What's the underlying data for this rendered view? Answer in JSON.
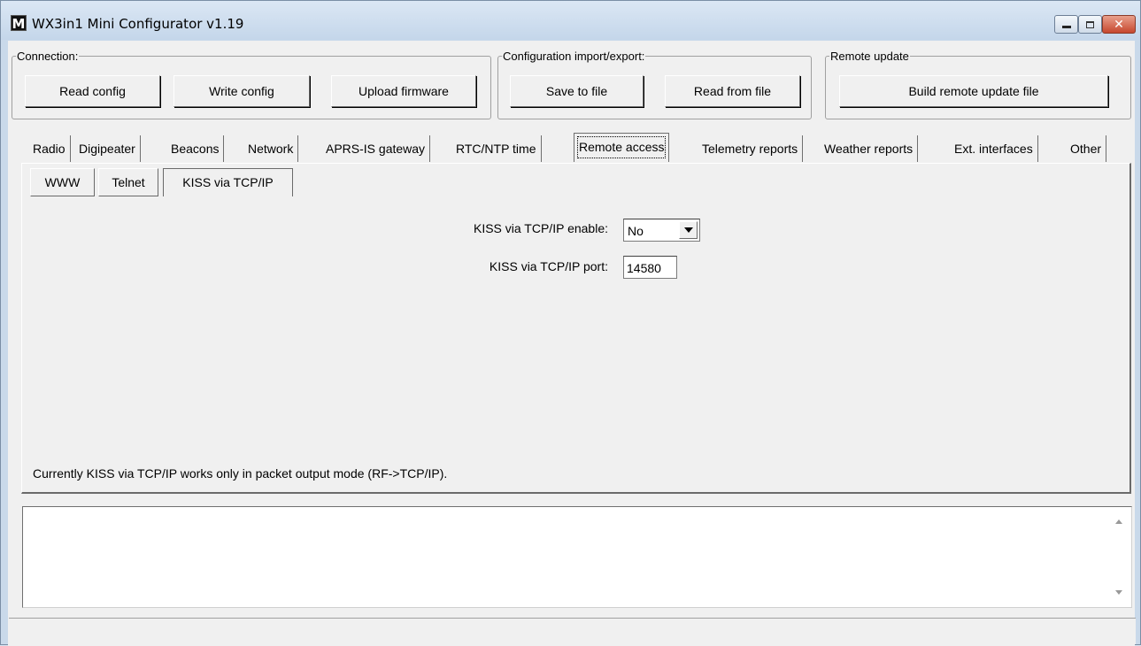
{
  "window": {
    "title": "WX3in1 Mini Configurator v1.19",
    "app_icon_letter": "M",
    "controls": [
      "minimize-icon",
      "maximize-icon",
      "close-icon"
    ]
  },
  "connection": {
    "legend": "Connection:",
    "read_config": "Read config",
    "write_config": "Write config",
    "upload_firmware": "Upload firmware"
  },
  "config_io": {
    "legend": "Configuration import/export:",
    "save_to_file": "Save to file",
    "read_from_file": "Read from file"
  },
  "remote_update": {
    "legend": "Remote update",
    "build": "Build remote update file"
  },
  "tabs": [
    {
      "label": "Radio"
    },
    {
      "label": "Digipeater"
    },
    {
      "label": "Beacons"
    },
    {
      "label": "Network"
    },
    {
      "label": "APRS-IS gateway"
    },
    {
      "label": "RTC/NTP time"
    },
    {
      "label": "Remote access",
      "active": true
    },
    {
      "label": "Telemetry reports"
    },
    {
      "label": "Weather reports"
    },
    {
      "label": "Ext. interfaces"
    },
    {
      "label": "Other"
    }
  ],
  "subtabs": [
    {
      "label": "WWW"
    },
    {
      "label": "Telnet"
    },
    {
      "label": "KISS via TCP/IP",
      "active": true
    }
  ],
  "kiss": {
    "enable_label": "KISS via TCP/IP enable:",
    "enable_value": "No",
    "port_label": "KISS via TCP/IP port:",
    "port_value": "14580",
    "note": "Currently KISS via TCP/IP works only in packet output mode (RF->TCP/IP)."
  },
  "log": {
    "text": ""
  },
  "status": {
    "text": ""
  }
}
